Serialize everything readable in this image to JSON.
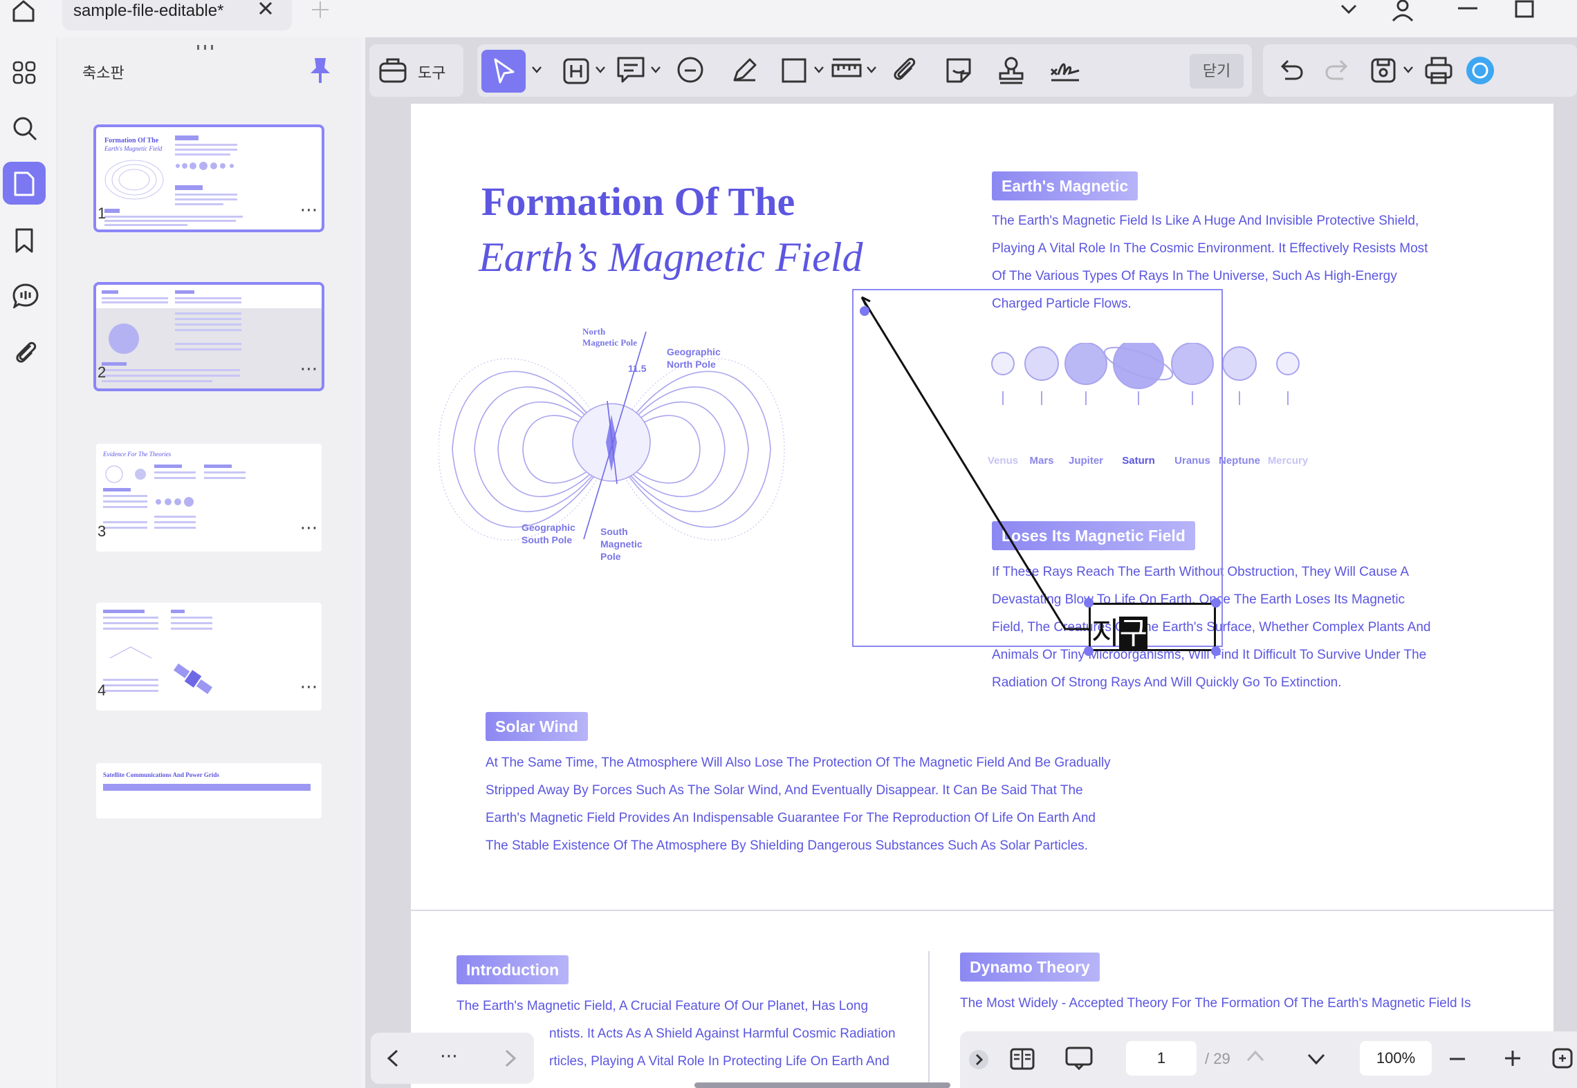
{
  "tabbar": {
    "tab_title": "sample-file-editable*"
  },
  "thumbnails": {
    "title": "축소판",
    "pages": [
      {
        "number": "1",
        "heading": "Formation Of The",
        "heading2": "Earth's Magnetic Field"
      },
      {
        "number": "2",
        "heading": "",
        "heading2": ""
      },
      {
        "number": "3",
        "heading": "Evidence For The Theories",
        "heading2": ""
      },
      {
        "number": "4",
        "heading": "",
        "heading2": ""
      },
      {
        "number": "",
        "heading": "Satellite Communications And Power Grids",
        "heading2": ""
      }
    ]
  },
  "toolbar": {
    "tools_label": "도구",
    "close_label": "닫기"
  },
  "page": {
    "title_line1": "Formation Of The",
    "title_line2": "Earth’s Magnetic Field",
    "sections": {
      "earths_magnetic": {
        "tag": "Earth's Magnetic",
        "lines": [
          "The Earth's Magnetic Field Is Like A Huge And Invisible Protective Shield,",
          "Playing A Vital Role In The Cosmic Environment. It Effectively Resists Most",
          "Of The Various Types Of Rays In The Universe, Such As High-Energy",
          "Charged Particle Flows."
        ]
      },
      "loses_field": {
        "tag": "Loses Its Magnetic Field",
        "lines": [
          "If These Rays Reach The Earth Without Obstruction, They Will Cause A",
          "Devastating Blow To Life On Earth. Once The Earth Loses Its Magnetic",
          "Field, The Creatures On The Earth's Surface, Whether Complex Plants And",
          "Animals Or Tiny Microorganisms, Will Find It Difficult To Survive Under The",
          "Radiation Of Strong Rays And Will Quickly Go To Extinction."
        ]
      },
      "solar_wind": {
        "tag": "Solar Wind",
        "lines": [
          "At The Same Time, The Atmosphere Will Also Lose The Protection Of The Magnetic Field And Be Gradually",
          "Stripped Away By Forces Such As The Solar Wind, And Eventually Disappear. It Can Be Said That The",
          "Earth's Magnetic Field Provides An Indispensable Guarantee For The Reproduction Of Life On Earth And",
          "The Stable Existence Of The Atmosphere By Shielding Dangerous Substances Such As Solar Particles."
        ]
      },
      "introduction": {
        "tag": "Introduction",
        "lines": [
          "The Earth's Magnetic Field, A Crucial Feature Of Our Planet, Has Long",
          "ntists. It Acts As A Shield Against Harmful Cosmic Radiation",
          "rticles, Playing A Vital Role In Protecting Life On Earth And"
        ]
      },
      "dynamo": {
        "tag": "Dynamo Theory",
        "lines": [
          "The Most Widely - Accepted Theory For The Formation Of The Earth's Magnetic Field Is"
        ]
      }
    },
    "diagram": {
      "north_magnetic_pole": [
        "North",
        "Magnetic Pole"
      ],
      "geographic_north_pole": [
        "Geographic",
        "North Pole"
      ],
      "angle": "11.5",
      "geographic_south_pole": [
        "Geographic",
        "South Pole"
      ],
      "south_magnetic_pole": [
        "South",
        "Magnetic",
        "Pole"
      ]
    },
    "planets": [
      "Venus",
      "Mars",
      "Jupiter",
      "Saturn",
      "Uranus",
      "Neptune",
      "Mercury"
    ],
    "annotation": {
      "text_plain": "지",
      "text_selected": "구"
    }
  },
  "status": {
    "current_page": "1",
    "total_pages": "/ 29",
    "zoom": "100%"
  },
  "colors": {
    "accent": "#7b78f2",
    "text_purple": "#5b56e0"
  }
}
